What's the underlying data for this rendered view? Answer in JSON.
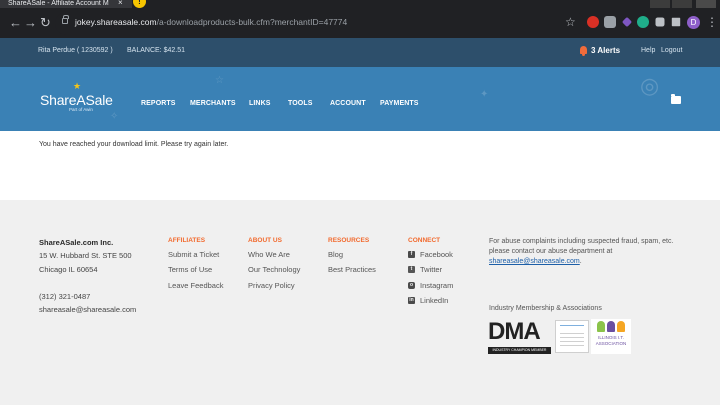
{
  "browser": {
    "tab_title": "ShareASale - Affiliate Account M",
    "tab_close": "×",
    "tab_alert_badge": "!",
    "url_host": "jokey.shareasale.com",
    "url_path": "/a-downloadproducts-bulk.cfm?merchantID=47774",
    "profile_initial": "D"
  },
  "account_bar": {
    "user": "Rita Perdue ( 1230592 )",
    "balance": "BALANCE: $42.51",
    "alerts": "3 Alerts",
    "help": "Help",
    "logout": "Logout"
  },
  "nav": {
    "logo": "ShareASale",
    "logo_sub": "Part of Awin",
    "items": [
      "REPORTS",
      "MERCHANTS",
      "LINKS",
      "TOOLS",
      "ACCOUNT",
      "PAYMENTS"
    ]
  },
  "content": {
    "message": "You have reached your download limit. Please try again later."
  },
  "footer": {
    "company": {
      "name": "ShareASale.com Inc.",
      "address1": "15 W. Hubbard St. STE 500",
      "address2": "Chicago IL 60654",
      "phone": "(312) 321-0487",
      "email": "shareasale@shareasale.com"
    },
    "affiliates": {
      "heading": "AFFILIATES",
      "links": [
        "Submit a Ticket",
        "Terms of Use",
        "Leave Feedback"
      ]
    },
    "about": {
      "heading": "ABOUT US",
      "links": [
        "Who We Are",
        "Our Technology",
        "Privacy Policy"
      ]
    },
    "resources": {
      "heading": "RESOURCES",
      "links": [
        "Blog",
        "Best Practices"
      ]
    },
    "connect": {
      "heading": "CONNECT",
      "links": [
        "Facebook",
        "Twitter",
        "Instagram",
        "LinkedIn"
      ]
    },
    "abuse_text": "For abuse complaints including suspected fraud, spam, etc. please contact our abuse department at",
    "abuse_email": "shareasale@shareasale.com",
    "abuse_end": ".",
    "membership_heading": "Industry Membership & Associations",
    "badges": {
      "dma": "DMA",
      "dma_band": "INDUSTRY CHAMPION MEMBER",
      "illinois": "ILLINOIS I.T. ASSOCIATION"
    }
  },
  "colors": {
    "nav_blue": "#3a81b5",
    "account_bar": "#2d4f6b",
    "footer_heading": "#f26a2e",
    "alert_bell": "#ef6b3b"
  }
}
